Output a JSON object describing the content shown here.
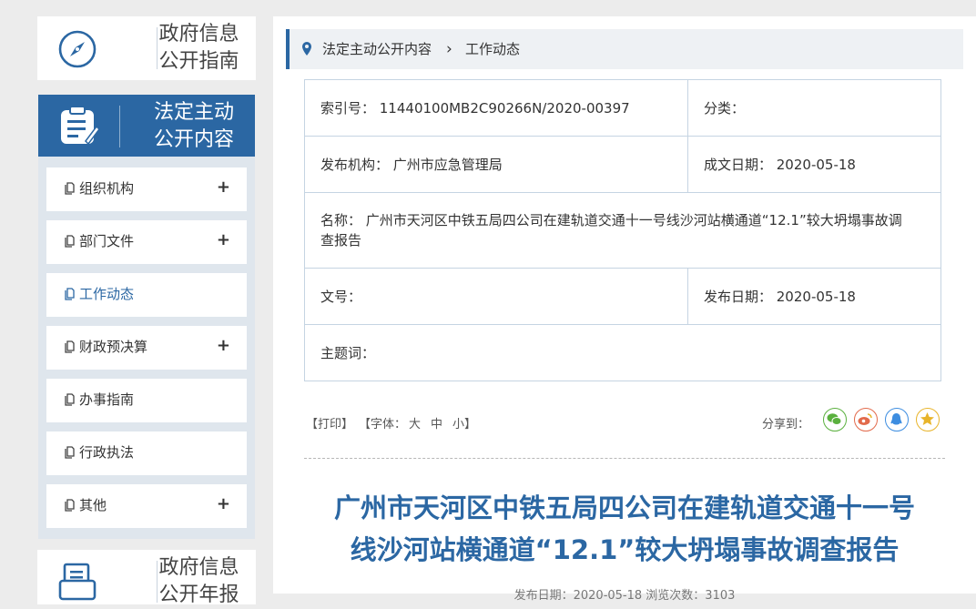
{
  "sidebar": {
    "guide": {
      "line1": "政府信息",
      "line2": "公开指南"
    },
    "active": {
      "line1": "法定主动",
      "line2": "公开内容"
    },
    "menu": [
      {
        "label": "组织机构",
        "expand": "+"
      },
      {
        "label": "部门文件",
        "expand": "+"
      },
      {
        "label": "工作动态",
        "expand": ""
      },
      {
        "label": "财政预决算",
        "expand": "+"
      },
      {
        "label": "办事指南",
        "expand": ""
      },
      {
        "label": "行政执法",
        "expand": ""
      },
      {
        "label": "其他",
        "expand": "+"
      }
    ],
    "report": {
      "line1": "政府信息",
      "line2": "公开年报"
    }
  },
  "breadcrumb": {
    "item1": "法定主动公开内容",
    "separator": "›",
    "item2": "工作动态"
  },
  "meta": {
    "index_no": "索引号： 11440100MB2C90266N/2020-00397",
    "category": "分类：",
    "publisher": "发布机构： 广州市应急管理局",
    "written_date": "成文日期： 2020-05-18",
    "name": "名称： 广州市天河区中铁五局四公司在建轨道交通十一号线沙河站横通道“12.1”较大坍塌事故调查报告",
    "doc_no": "文号：",
    "publish_date": "发布日期： 2020-05-18",
    "keywords": "主题词："
  },
  "tools": {
    "print": "【打印】",
    "font_prefix": "【字体：",
    "font_large": "大",
    "font_medium": "中",
    "font_small": "小",
    "font_suffix": "】",
    "share_label": "分享到："
  },
  "article": {
    "title_line1": "广州市天河区中铁五局四公司在建轨道交通十一号",
    "title_line2": "线沙河站横通道“12.1”较大坍塌事故调查报告",
    "pubinfo": "发布日期：2020-05-18 浏览次数：3103"
  },
  "colors": {
    "accent": "#2b67a3",
    "wechat": "#5ab03e",
    "weibo": "#e26a4b",
    "qq": "#3d8de0",
    "favorite": "#e8b42a"
  },
  "icons": {
    "guide": "compass-icon",
    "active": "clipboard-icon",
    "report": "document-icon",
    "menu": "document-icon",
    "breadcrumb": "location-pin-icon"
  }
}
